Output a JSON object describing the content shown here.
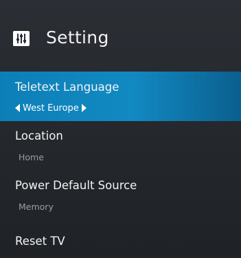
{
  "header": {
    "title": "Setting",
    "icon": "sliders-icon"
  },
  "menu": {
    "items": [
      {
        "label": "Teletext Language",
        "value": "West Europe",
        "selected": true
      },
      {
        "label": "Location",
        "value": "Home",
        "selected": false
      },
      {
        "label": "Power Default Source",
        "value": "Memory",
        "selected": false
      },
      {
        "label": "Reset TV",
        "selected": false
      }
    ]
  },
  "colors": {
    "accent": "#1289c2",
    "background": "#26292e",
    "text": "#f4f4f4",
    "secondary_text": "#9a9ea4"
  }
}
